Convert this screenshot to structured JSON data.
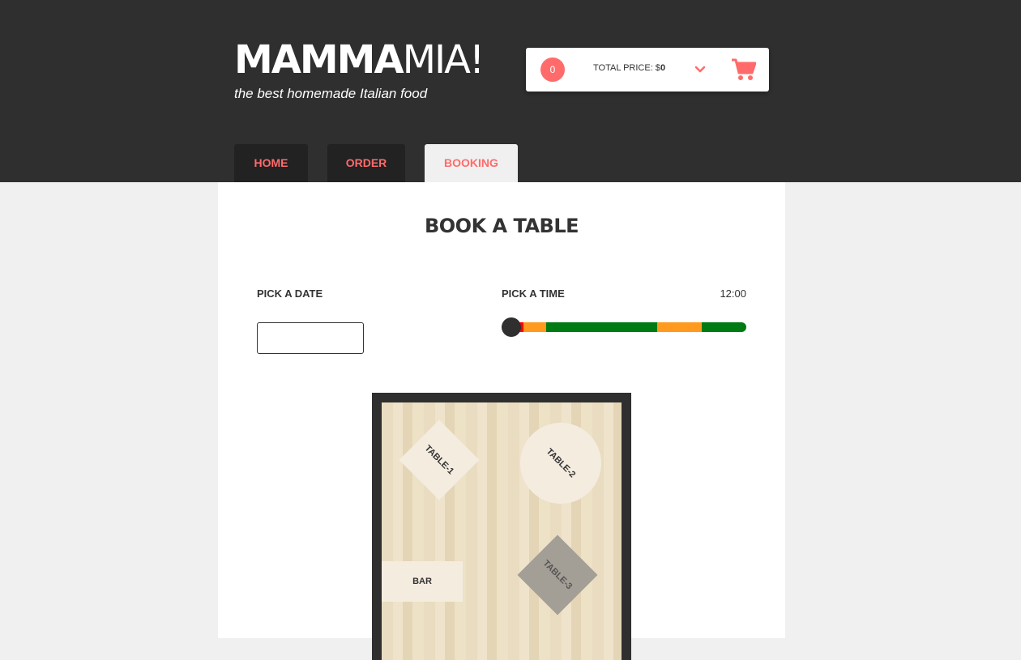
{
  "header": {
    "logo_bold": "MAMMA",
    "logo_light": "MIA!",
    "tagline": "the best homemade Italian food"
  },
  "cart": {
    "count": "0",
    "total_label": "TOTAL PRICE: $",
    "total_value": "0"
  },
  "nav": {
    "tabs": [
      {
        "label": "HOME",
        "active": false
      },
      {
        "label": "ORDER",
        "active": false
      },
      {
        "label": "BOOKING",
        "active": true
      }
    ]
  },
  "booking": {
    "title": "BOOK A TABLE",
    "date_label": "PICK A DATE",
    "date_value": "",
    "time_label": "PICK A TIME",
    "time_value": "12:00",
    "time_slider": {
      "value_fraction": 0,
      "segments": [
        {
          "color": "#ff0000",
          "weight": 1
        },
        {
          "color": "#ff9a1f",
          "weight": 1
        },
        {
          "color": "#007a12",
          "weight": 5
        },
        {
          "color": "#ff9a1f",
          "weight": 2
        },
        {
          "color": "#007a12",
          "weight": 2
        }
      ]
    },
    "floor_plan": {
      "tables": [
        {
          "label": "TABLE-1",
          "status": "available"
        },
        {
          "label": "TABLE-2",
          "status": "available"
        },
        {
          "label": "TABLE-3",
          "status": "booked"
        }
      ],
      "bar_label": "BAR"
    }
  },
  "colors": {
    "accent": "#ff6b6b",
    "dark": "#2f2f2f",
    "booked": "#a39e96"
  }
}
